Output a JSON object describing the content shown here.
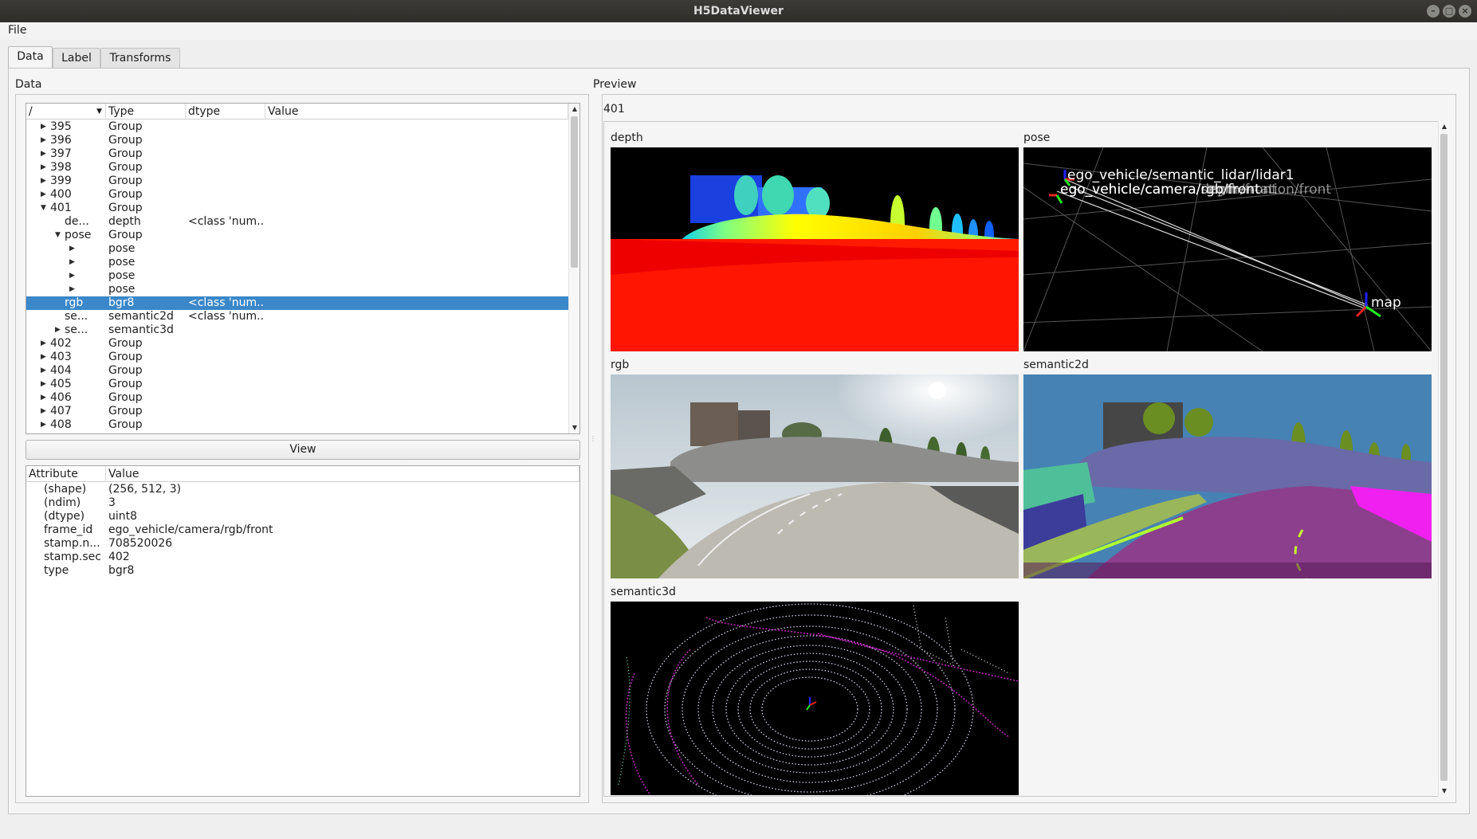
{
  "window": {
    "title": "H5DataViewer",
    "controls": [
      "–",
      "□",
      "×"
    ]
  },
  "menu": {
    "file": "File"
  },
  "tabs": [
    {
      "label": "Data",
      "active": true
    },
    {
      "label": "Label",
      "active": false
    },
    {
      "label": "Transforms",
      "active": false
    }
  ],
  "data_panel": {
    "title": "Data",
    "tree": {
      "headers": [
        "/",
        "Type",
        "dtype",
        "Value"
      ],
      "rows": [
        {
          "level": 0,
          "arrow": "right",
          "name": "395",
          "type": "Group",
          "value": ""
        },
        {
          "level": 0,
          "arrow": "right",
          "name": "396",
          "type": "Group",
          "value": ""
        },
        {
          "level": 0,
          "arrow": "right",
          "name": "397",
          "type": "Group",
          "value": ""
        },
        {
          "level": 0,
          "arrow": "right",
          "name": "398",
          "type": "Group",
          "value": ""
        },
        {
          "level": 0,
          "arrow": "right",
          "name": "399",
          "type": "Group",
          "value": ""
        },
        {
          "level": 0,
          "arrow": "right",
          "name": "400",
          "type": "Group",
          "value": ""
        },
        {
          "level": 0,
          "arrow": "down",
          "name": "401",
          "type": "Group",
          "value": ""
        },
        {
          "level": 1,
          "arrow": "",
          "name": "de...",
          "type": "depth",
          "value": "<class 'num..."
        },
        {
          "level": 1,
          "arrow": "down",
          "name": "pose",
          "type": "Group",
          "value": ""
        },
        {
          "level": 2,
          "arrow": "right",
          "name": "",
          "type": "pose",
          "value": ""
        },
        {
          "level": 2,
          "arrow": "right",
          "name": "",
          "type": "pose",
          "value": ""
        },
        {
          "level": 2,
          "arrow": "right",
          "name": "",
          "type": "pose",
          "value": ""
        },
        {
          "level": 2,
          "arrow": "right",
          "name": "",
          "type": "pose",
          "value": ""
        },
        {
          "level": 1,
          "arrow": "",
          "name": "rgb",
          "type": "bgr8",
          "value": "<class 'num...",
          "selected": true
        },
        {
          "level": 1,
          "arrow": "",
          "name": "se...",
          "type": "semantic2d",
          "value": "<class 'num..."
        },
        {
          "level": 1,
          "arrow": "right",
          "name": "se...",
          "type": "semantic3d",
          "value": ""
        },
        {
          "level": 0,
          "arrow": "right",
          "name": "402",
          "type": "Group",
          "value": ""
        },
        {
          "level": 0,
          "arrow": "right",
          "name": "403",
          "type": "Group",
          "value": ""
        },
        {
          "level": 0,
          "arrow": "right",
          "name": "404",
          "type": "Group",
          "value": ""
        },
        {
          "level": 0,
          "arrow": "right",
          "name": "405",
          "type": "Group",
          "value": ""
        },
        {
          "level": 0,
          "arrow": "right",
          "name": "406",
          "type": "Group",
          "value": ""
        },
        {
          "level": 0,
          "arrow": "right",
          "name": "407",
          "type": "Group",
          "value": ""
        },
        {
          "level": 0,
          "arrow": "right",
          "name": "408",
          "type": "Group",
          "value": ""
        }
      ]
    },
    "view_button": "View",
    "attributes": {
      "headers": [
        "Attribute",
        "Value"
      ],
      "rows": [
        {
          "name": "(shape)",
          "value": "(256, 512, 3)"
        },
        {
          "name": "(ndim)",
          "value": "3"
        },
        {
          "name": "(dtype)",
          "value": "uint8"
        },
        {
          "name": "frame_id",
          "value": "ego_vehicle/camera/rgb/front"
        },
        {
          "name": "stamp.n...",
          "value": "708520026"
        },
        {
          "name": "stamp.sec",
          "value": "402"
        },
        {
          "name": "type",
          "value": "bgr8"
        }
      ]
    }
  },
  "preview_panel": {
    "title": "Preview",
    "sample_id": "401",
    "panels": [
      {
        "label": "depth"
      },
      {
        "label": "pose",
        "frame_labels": [
          "ego_vehicle/semantic_lidar/lidar1",
          "ego_vehicle/camera/rgb/front",
          "ego_vehicle/camera/depth/front",
          "ego_vehicle/camera/segmentation/front",
          "map"
        ]
      },
      {
        "label": "rgb"
      },
      {
        "label": "semantic2d"
      },
      {
        "label": "semantic3d"
      }
    ]
  },
  "colors": {
    "selection": "#3a87c9",
    "titlebar": "#2e2d2a"
  }
}
